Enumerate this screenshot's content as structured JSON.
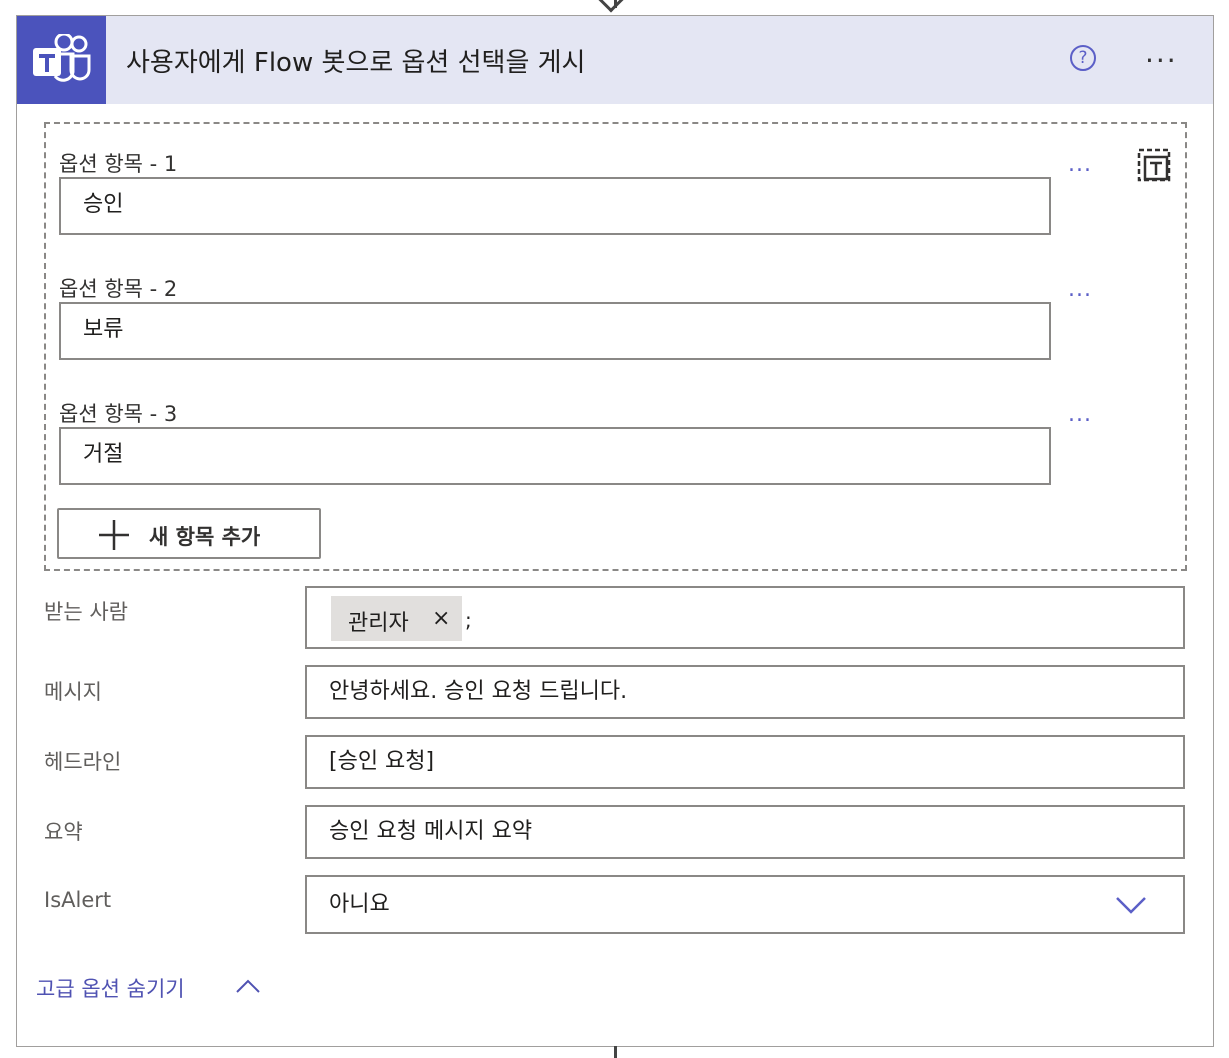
{
  "action": {
    "title": "사용자에게 Flow 봇으로 옵션 선택을 게시",
    "icon": "teams-icon",
    "help_glyph": "?",
    "more_glyph": "..."
  },
  "options": {
    "items": [
      {
        "label": "옵션 항목 - 1",
        "value": "승인"
      },
      {
        "label": "옵션 항목 - 2",
        "value": "보류"
      },
      {
        "label": "옵션 항목 - 3",
        "value": "거절"
      }
    ],
    "item_more_glyph": "...",
    "add_label": "새 항목 추가"
  },
  "fields": {
    "recipient": {
      "label": "받는 사람",
      "token": "관리자",
      "token_remove": "×",
      "separator": ";"
    },
    "message": {
      "label": "메시지",
      "value": "안녕하세요. 승인 요청 드립니다."
    },
    "headline": {
      "label": "헤드라인",
      "value": "[승인 요청]"
    },
    "summary": {
      "label": "요약",
      "value": "승인 요청 메시지 요약"
    },
    "isalert": {
      "label": "IsAlert",
      "value": "아니요"
    }
  },
  "advanced_toggle": "고급 옵션 숨기기",
  "colors": {
    "accent": "#5b5fc7",
    "header_bg": "#e4e6f3",
    "teams_tile": "#4b53bc"
  }
}
